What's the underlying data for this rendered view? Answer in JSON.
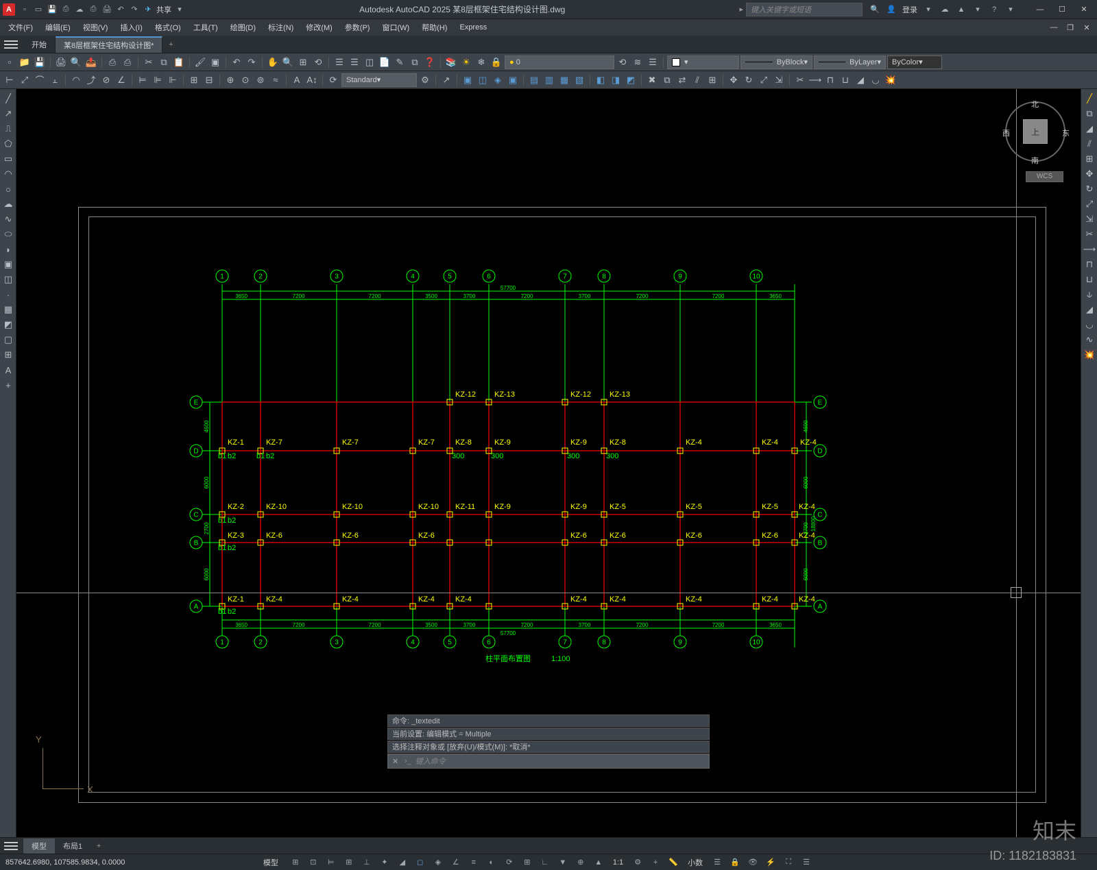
{
  "titlebar": {
    "app_letter": "A",
    "title": "Autodesk AutoCAD 2025    某8层框架住宅结构设计图.dwg",
    "search_placeholder": "键入关键字或短语",
    "login": "登录",
    "share": "共享"
  },
  "menus": [
    "文件(F)",
    "编辑(E)",
    "视图(V)",
    "插入(I)",
    "格式(O)",
    "工具(T)",
    "绘图(D)",
    "标注(N)",
    "修改(M)",
    "参数(P)",
    "窗口(W)",
    "帮助(H)",
    "Express"
  ],
  "doc_tabs": {
    "start": "开始",
    "active": "某8层框架住宅结构设计图*"
  },
  "toolbar2": {
    "layer": "0",
    "linetype": "ByBlock",
    "lineweight": "ByLayer",
    "color": "ByColor",
    "style": "Standard"
  },
  "viewcube": {
    "n": "北",
    "s": "南",
    "e": "东",
    "w": "西",
    "face": "上",
    "wcs": "WCS"
  },
  "ucs": {
    "x": "X",
    "y": "Y"
  },
  "drawing": {
    "title": "柱平面布置图",
    "scale": "1:100",
    "total_span": "57700",
    "grid_cols": [
      "1",
      "2",
      "3",
      "4",
      "5",
      "6",
      "7",
      "8",
      "9",
      "10"
    ],
    "grid_rows": [
      "A",
      "B",
      "C",
      "D",
      "E"
    ],
    "col_dims": [
      "3650",
      "7200",
      "7200",
      "3500",
      "3700",
      "7200",
      "3700",
      "7200",
      "7200",
      "3650"
    ],
    "row_dims": [
      "6000",
      "2700",
      "6000",
      "4600"
    ],
    "total_h": "18800",
    "kz_labels": [
      "KZ-1",
      "KZ-2",
      "KZ-3",
      "KZ-4",
      "KZ-5",
      "KZ-6",
      "KZ-7",
      "KZ-8",
      "KZ-9",
      "KZ-10",
      "KZ-11",
      "KZ-12",
      "KZ-13"
    ],
    "b_labels": [
      "b1",
      "b2",
      "300"
    ]
  },
  "command": {
    "l1": "命令: _textedit",
    "l2": "当前设置: 编辑模式 = Multiple",
    "l3": "选择注释对象或 [放弃(U)/模式(M)]: *取消*",
    "prompt": "键入命令"
  },
  "bottom_tabs": {
    "model": "模型",
    "layout": "布局1"
  },
  "status": {
    "coords": "857642.6980, 107585.9834, 0.0000",
    "model": "模型",
    "scale": "1:1",
    "decimal": "小数"
  },
  "watermark": {
    "brand": "知末",
    "id": "ID: 1182183831"
  }
}
